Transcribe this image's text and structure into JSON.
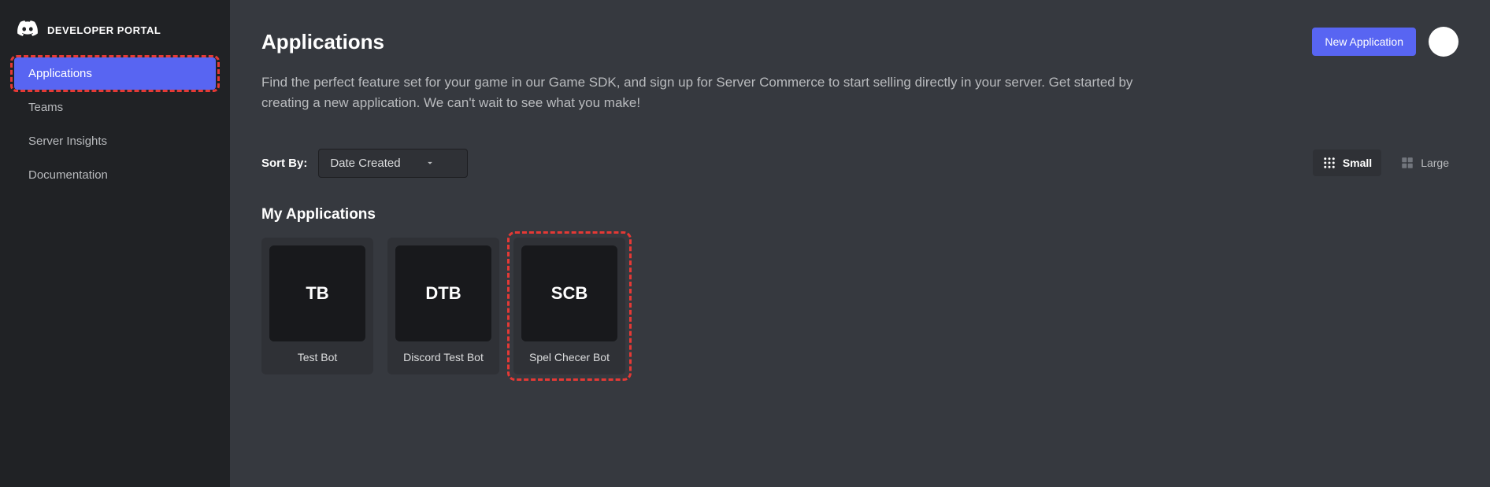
{
  "brand": {
    "label": "DEVELOPER PORTAL"
  },
  "sidebar": {
    "items": [
      {
        "label": "Applications",
        "active": true,
        "highlight": true
      },
      {
        "label": "Teams",
        "active": false,
        "highlight": false
      },
      {
        "label": "Server Insights",
        "active": false,
        "highlight": false
      },
      {
        "label": "Documentation",
        "active": false,
        "highlight": false
      }
    ]
  },
  "header": {
    "title": "Applications",
    "new_button": "New Application"
  },
  "description": "Find the perfect feature set for your game in our Game SDK, and sign up for Server Commerce to start selling directly in your server. Get started by creating a new application. We can't wait to see what you make!",
  "sort": {
    "label": "Sort By:",
    "selected": "Date Created"
  },
  "view": {
    "small": "Small",
    "large": "Large"
  },
  "section_title": "My Applications",
  "apps": [
    {
      "initials": "TB",
      "name": "Test Bot",
      "highlight": false
    },
    {
      "initials": "DTB",
      "name": "Discord Test Bot",
      "highlight": false
    },
    {
      "initials": "SCB",
      "name": "Spel Checer Bot",
      "highlight": true
    }
  ],
  "colors": {
    "accent": "#5865f2",
    "highlight": "#e53935"
  }
}
